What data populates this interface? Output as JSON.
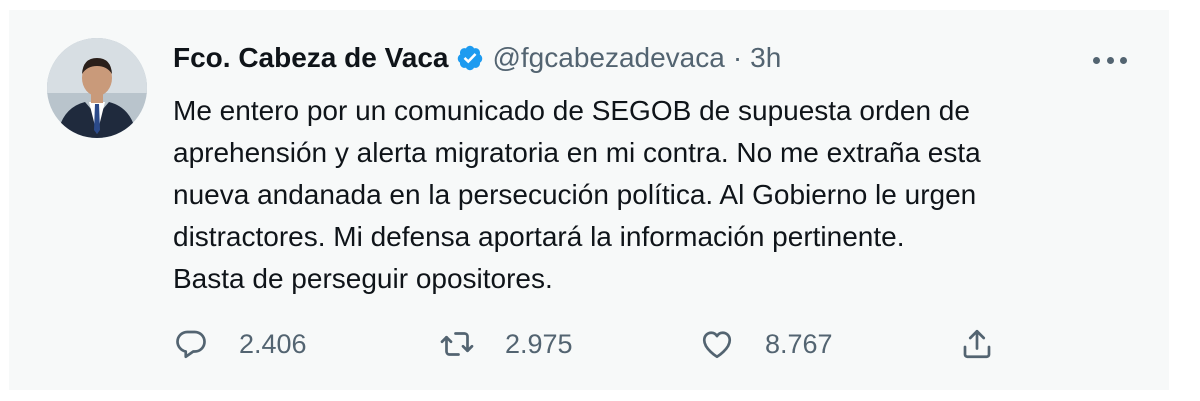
{
  "tweet": {
    "author_name": "Fco. Cabeza de Vaca",
    "handle": "@fgcabezadevaca",
    "separator": "·",
    "time": "3h",
    "verified": true,
    "text": "Me entero por un comunicado de SEGOB de supuesta orden de\naprehensión y alerta migratoria en mi contra. No me extraña esta\nnueva andanada en la persecución política. Al Gobierno le urgen\ndistractores. Mi defensa aportará la información pertinente.\nBasta de perseguir opositores.",
    "replies": "2.406",
    "retweets": "2.975",
    "likes": "8.767"
  },
  "icons": {
    "verified": "verified-badge-icon",
    "more": "more-options-icon",
    "reply": "reply-icon",
    "retweet": "retweet-icon",
    "like": "heart-icon",
    "share": "share-icon"
  },
  "colors": {
    "card_background": "#f7f9f9",
    "verified_blue": "#1d9bf0",
    "secondary_text": "#536471",
    "primary_text": "#0f1419"
  }
}
